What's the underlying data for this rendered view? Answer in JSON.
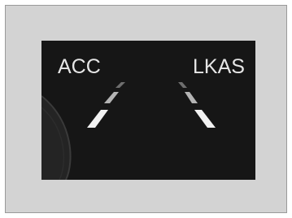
{
  "indicators": {
    "acc_label": "ACC",
    "lkas_label": "LKAS"
  },
  "icons": {
    "left_lane": "left-lane-marking-icon",
    "right_lane": "right-lane-marking-icon",
    "gauge_arc": "gauge-arc-icon"
  },
  "colors": {
    "frame_background": "#d3d3d3",
    "display_background": "#161616",
    "text": "#e6e6e6",
    "lane_bright": "#f2f2f2",
    "lane_mid": "#b4b4b4",
    "lane_dim": "#6e6e6e"
  }
}
